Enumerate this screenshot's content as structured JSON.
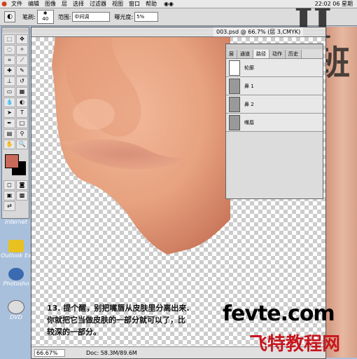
{
  "menubar": {
    "items": [
      "文件",
      "编辑",
      "图像",
      "层",
      "选择",
      "过滤器",
      "视图",
      "窗口",
      "帮助"
    ],
    "clock": "22:02 06 星期"
  },
  "options": {
    "brush_label": "笔刷:",
    "brush_size": "40",
    "mode_label": "范围:",
    "mode_value": "中间调",
    "exposure_label": "曝光度:",
    "exposure_value": "5%"
  },
  "document": {
    "title": "003.psd @ 66.7% (层 3,CMYK)",
    "zoom": "66.67%",
    "doc_size": "Doc: 58.3M/89.6M"
  },
  "paths_panel": {
    "tabs": [
      "层",
      "通道",
      "路径",
      "动作",
      "历史"
    ],
    "active_tab": 2,
    "rows": [
      "轮廓",
      "鼻 1",
      "鼻 2",
      "嘴唇"
    ]
  },
  "desktop_icons": [
    "Internet",
    "Outlook Ex",
    "Photosho",
    "DVD"
  ],
  "caption": {
    "line1": "13. 提个醒，别把嘴唇从皮肤里分离出来.",
    "line2": "你就把它当做皮肤的一部分就可以了，比",
    "line3": "较深的一部分。"
  },
  "watermark": {
    "top": "fevte.com",
    "bottom": "飞特教程网",
    "big1": "II",
    "big2": "班"
  },
  "colors": {
    "foreground": "#c8695a",
    "background": "#000000"
  }
}
